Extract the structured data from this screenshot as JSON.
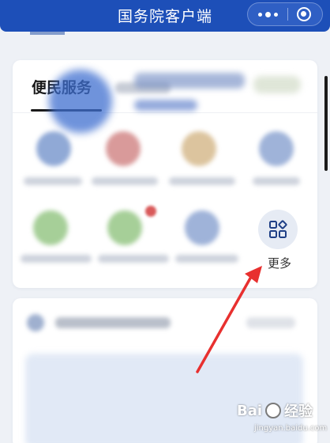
{
  "app": {
    "title": "国务院客户端"
  },
  "services_card": {
    "active_tab": "便民服务",
    "more_label": "更多"
  },
  "watermark": {
    "text": "Bai",
    "text2": "经验",
    "sub": "jingyan.baidu.com"
  },
  "colors": {
    "brand_blue": "#1d4fb8",
    "annotation_arrow": "#e8302f"
  },
  "icons": {
    "capsule_more": "three-dots-icon",
    "capsule_close": "target-circle-icon",
    "more": "grid-apps-icon"
  }
}
